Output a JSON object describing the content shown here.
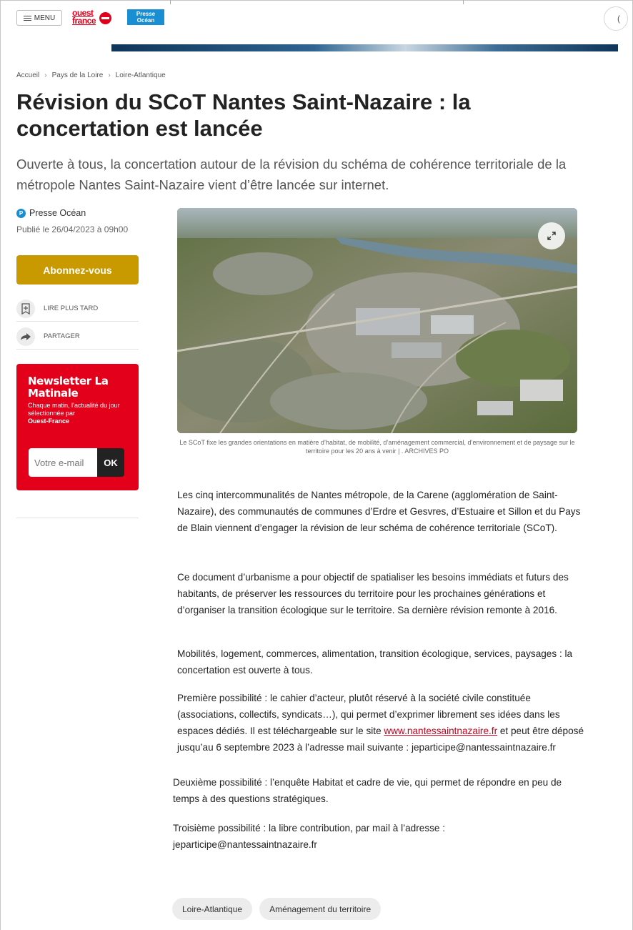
{
  "header": {
    "menu_label": "MENU",
    "logo_ouest_line1": "ouest",
    "logo_ouest_line2": "france",
    "logo_presse_line1": "Presse",
    "logo_presse_line2": "Océan",
    "search_hint": "("
  },
  "breadcrumb": [
    "Accueil",
    "Pays de la Loire",
    "Loire-Atlantique"
  ],
  "article": {
    "title": "Révision du SCoT Nantes Saint-Nazaire : la concertation est lancée",
    "subtitle": "Ouverte à tous, la concertation autour de la révision du schéma de cohérence territoriale de la métropole Nantes Saint-Nazaire vient d’être lancée sur internet.",
    "author": "Presse Océan",
    "published": "Publié le 26/04/2023 à 09h00",
    "image_caption": "Le SCoT fixe les grandes orientations en matière d’habitat, de mobilité, d’aménagement commercial, d’environnement et de paysage sur le territoire pour les 20 ans à venir | . ARCHIVES PO",
    "paragraphs": {
      "p1": "Les cinq intercommunalités de Nantes métropole, de la Carene (agglomération de Saint-Nazaire), des communautés de communes d’Erdre et Gesvres, d’Estuaire et Sillon et du Pays de Blain viennent d’engager la révision de leur schéma de cohérence territoriale (SCoT).",
      "p2": "Ce document d’urbanisme a pour objectif de spatialiser les besoins immédiats et futurs des habitants, de préserver les ressources du territoire pour les prochaines générations et d’organiser la transition écologique sur le territoire. Sa dernière révision remonte à 2016.",
      "p3": "Mobilités, logement, commerces, alimentation, transition écologique, services, paysages : la concertation est ouverte à tous.",
      "p4_before": "Première possibilité : le cahier d’acteur, plutôt réservé à la société civile constituée (associations, collectifs, syndicats…), qui permet d’exprimer librement ses idées dans les espaces dédiés. Il est téléchargeable sur le site ",
      "p4_link": "www.nantessaintnazaire.fr",
      "p4_after": " et peut être déposé jusqu’au 6 septembre 2023 à l’adresse mail suivante : jeparticipe@nantessaintnazaire.fr",
      "p5": "Deuxième possibilité : l’enquête Habitat et cadre de vie, qui permet de répondre en peu de temps à des questions stratégiques.",
      "p6": "Troisième possibilité : la libre contribution, par mail à l’adresse : jeparticipe@nantessaintnazaire.fr"
    },
    "tags": [
      "Loire-Atlantique",
      "Aménagement du territoire"
    ]
  },
  "sidebar": {
    "subscribe_label": "Abonnez-vous",
    "read_later_label": "LIRE PLUS TARD",
    "share_label": "PARTAGER",
    "newsletter": {
      "title": "Newsletter La Matinale",
      "description": "Chaque matin, l’actualité du jour sélectionnée par",
      "brand": "Ouest-France",
      "email_placeholder": "Votre e-mail",
      "ok_label": "OK"
    }
  },
  "colors": {
    "brand_red": "#e3001b",
    "subscribe_gold": "#c99a00",
    "presse_blue": "#1a8ed3",
    "link_red": "#c8001b"
  }
}
